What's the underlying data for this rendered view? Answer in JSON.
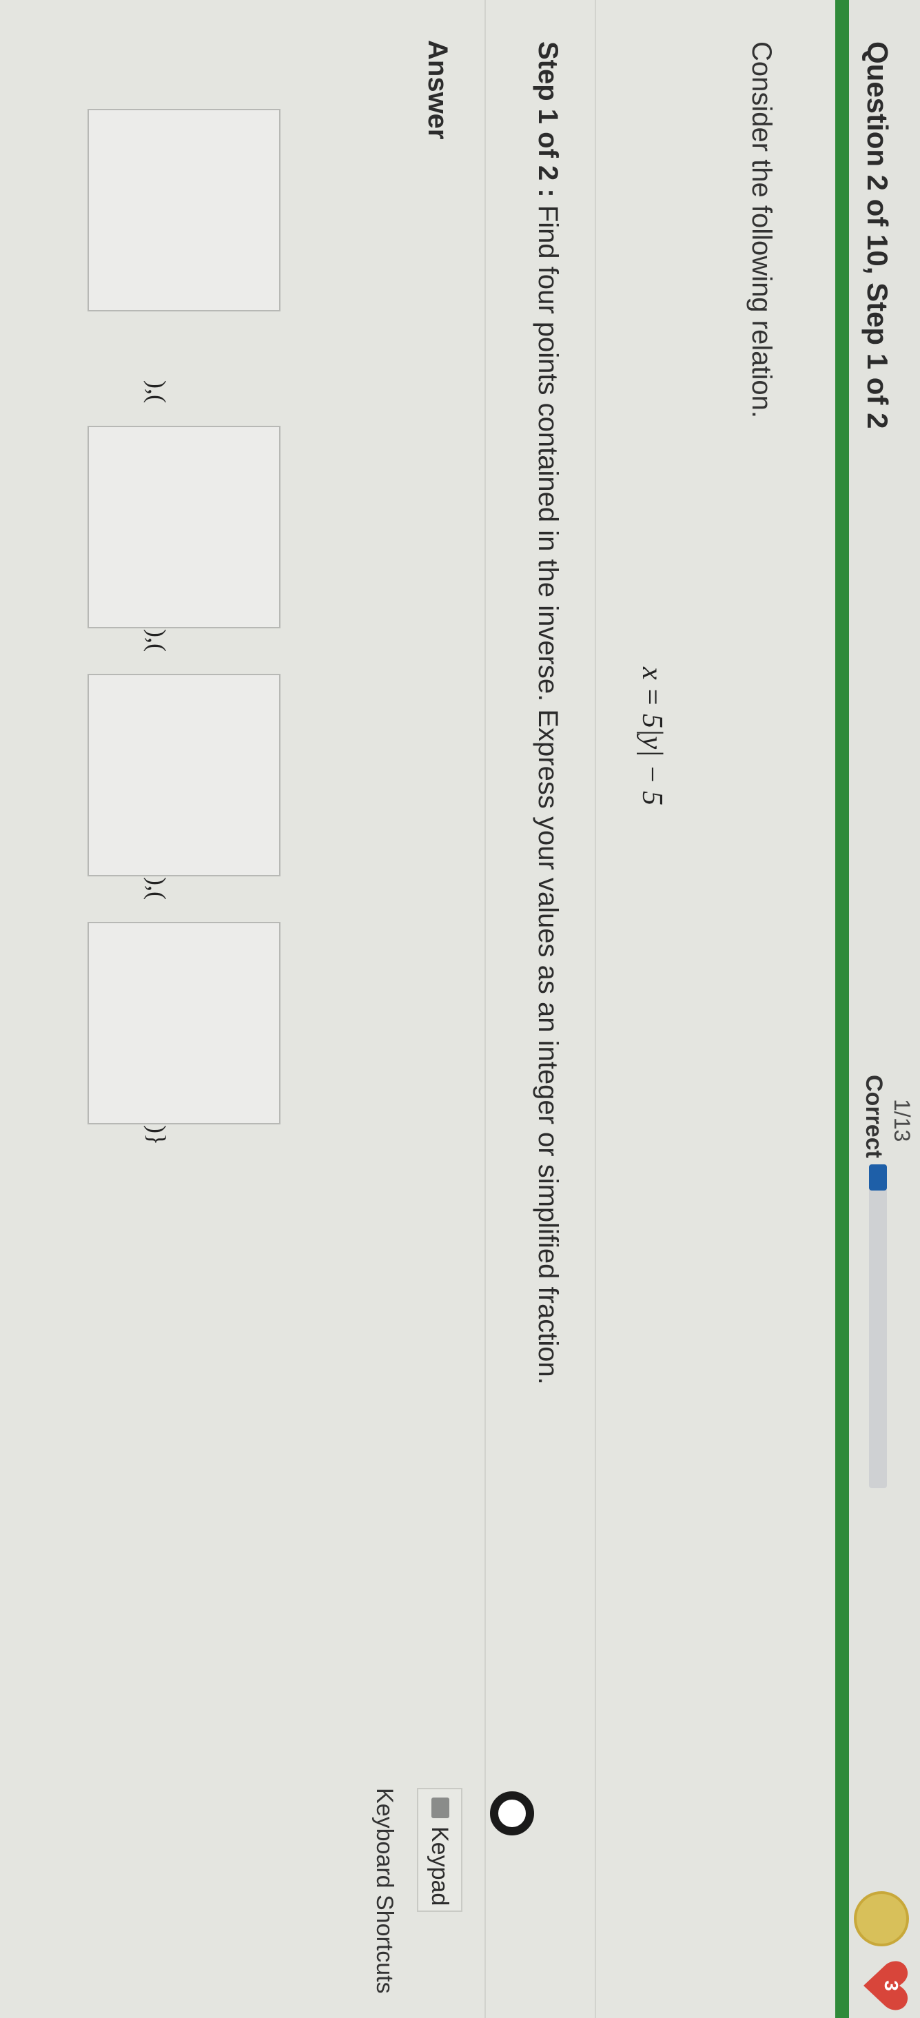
{
  "header": {
    "question_title": "Question 2 of 10, Step 1 of 2",
    "progress_fraction": "1/13",
    "progress_status": "Correct",
    "progress_value": 0.08,
    "heart_count": "3"
  },
  "problem": {
    "intro": "Consider the following relation.",
    "equation": "x = 5|y| − 5",
    "step_label": "Step 1 of 2 :",
    "step_text": "Find four points contained in the inverse. Express your values as an integer or simplified fraction."
  },
  "answer": {
    "label": "Answer",
    "separators": [
      "{(|",
      "),(",
      "),(",
      "),(",
      ")}"
    ],
    "fields": [
      "",
      "",
      "",
      ""
    ]
  },
  "tools": {
    "keypad_label": "Keypad",
    "shortcuts_label": "Keyboard Shortcuts"
  },
  "colors": {
    "accent_green": "#2f8a3a",
    "progress_blue": "#1e5fa8",
    "heart_red": "#d8453a"
  }
}
